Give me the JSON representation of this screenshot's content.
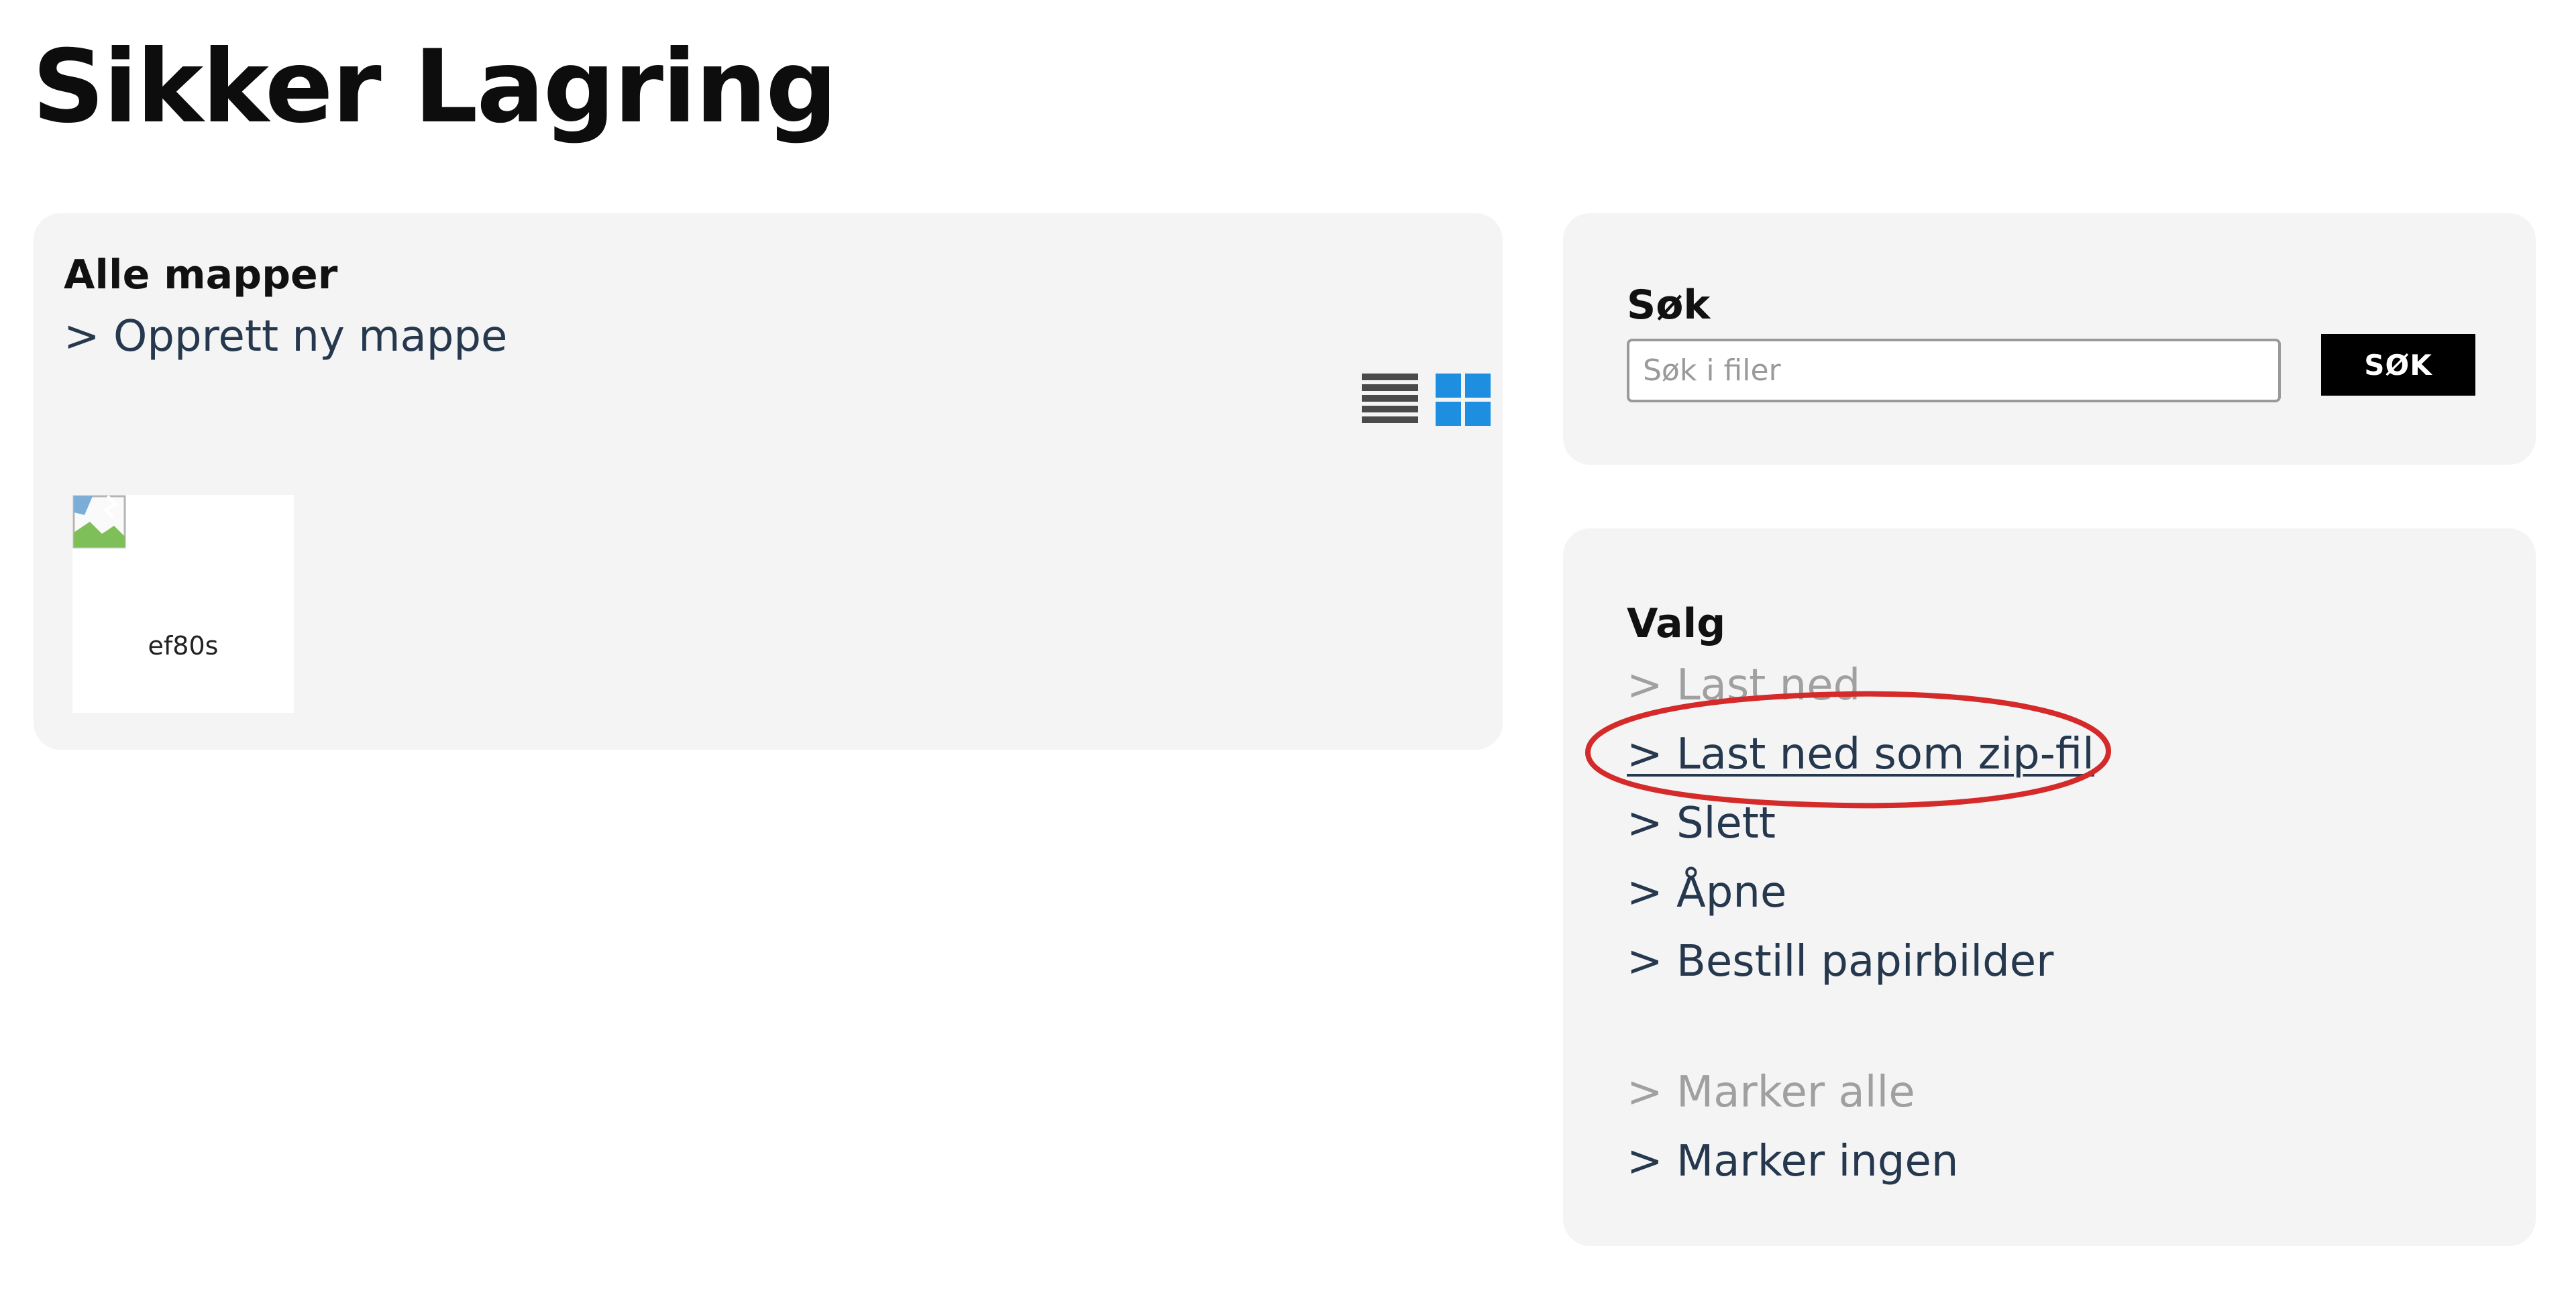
{
  "page": {
    "title": "Sikker Lagring"
  },
  "folders_panel": {
    "heading": "Alle mapper",
    "create_folder_link": "> Opprett ny mappe",
    "view_toggle": {
      "list_icon": "list-view-icon",
      "grid_icon": "grid-view-icon",
      "active": "grid"
    },
    "items": [
      {
        "name": "ef80s",
        "thumbnail_icon": "broken-image-icon"
      }
    ]
  },
  "search_panel": {
    "heading": "Søk",
    "input_placeholder": "Søk i filer",
    "input_value": "",
    "button_label": "SØK"
  },
  "options_panel": {
    "heading": "Valg",
    "actions": [
      {
        "label": "> Last ned",
        "enabled": false
      },
      {
        "label": "> Last ned som zip-fil",
        "enabled": true,
        "underlined": true,
        "highlighted": true
      },
      {
        "label": "> Slett",
        "enabled": true
      },
      {
        "label": "> Åpne",
        "enabled": true
      },
      {
        "label": "> Bestill papirbilder",
        "enabled": true
      }
    ],
    "selection": [
      {
        "label": "> Marker alle",
        "enabled": false
      },
      {
        "label": "> Marker ingen",
        "enabled": true
      }
    ]
  },
  "annotation": {
    "highlight_color": "#d42a2a",
    "target": "> Last ned som zip-fil"
  },
  "colors": {
    "link": "#26384e",
    "link_disabled": "#a0a0a0",
    "panel_background": "#f4f4f4",
    "grid_icon_active": "#1e8fe0",
    "list_icon": "#4a4a4a",
    "button_background": "#000000"
  }
}
